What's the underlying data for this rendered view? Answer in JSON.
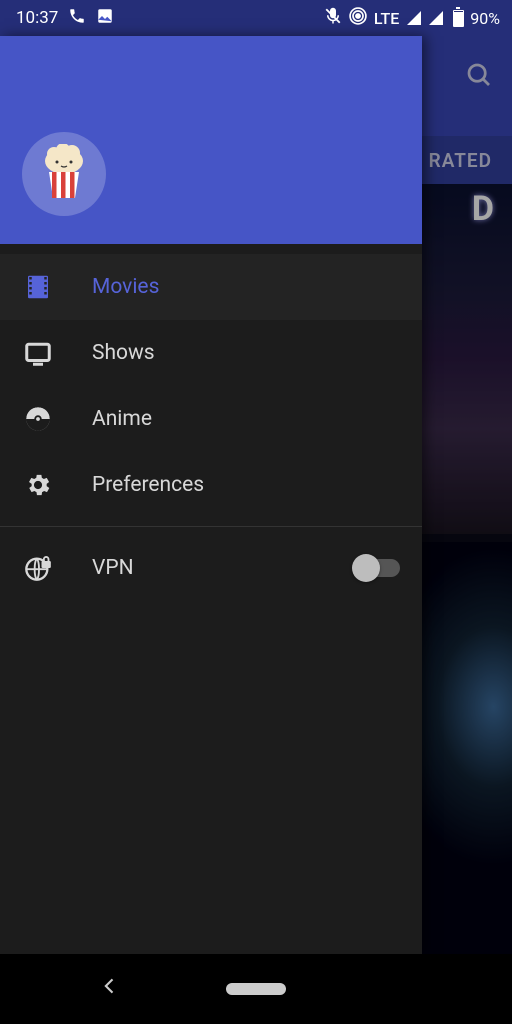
{
  "status_bar": {
    "time": "10:37",
    "lte_label": "LTE",
    "battery_pct": "90%",
    "icons": {
      "phone": "phone-icon",
      "image": "image-icon",
      "mic_muted": "mic-muted-icon",
      "hotspot": "hotspot-icon"
    }
  },
  "background": {
    "search_icon": "search",
    "tab_visible_label": "RATED",
    "poster_letter": "D"
  },
  "drawer": {
    "avatar_icon": "popcorn-bucket",
    "items": [
      {
        "label": "Movies",
        "icon": "film-strip-icon",
        "active": true
      },
      {
        "label": "Shows",
        "icon": "tv-icon",
        "active": false
      },
      {
        "label": "Anime",
        "icon": "pokeball-icon",
        "active": false
      },
      {
        "label": "Preferences",
        "icon": "gear-icon",
        "active": false
      }
    ],
    "vpn": {
      "label": "VPN",
      "icon": "globe-lock-icon",
      "enabled": false
    }
  },
  "nav": {
    "back": "back",
    "home": "home-pill"
  }
}
